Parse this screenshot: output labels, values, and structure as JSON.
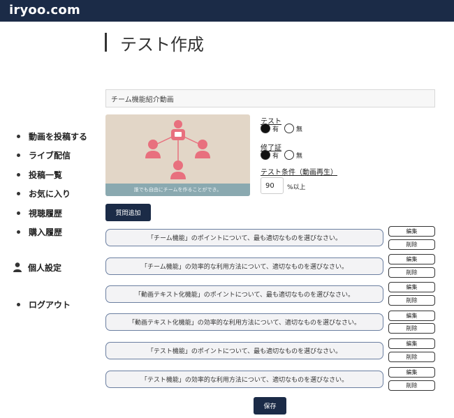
{
  "header": {
    "logo": "iryoo.com"
  },
  "sidebar": {
    "items": [
      {
        "label": "動画を投稿する"
      },
      {
        "label": "ライブ配信"
      },
      {
        "label": "投稿一覧"
      },
      {
        "label": "お気に入り"
      },
      {
        "label": "視聴履歴"
      },
      {
        "label": "購入履歴"
      },
      {
        "label": "個人設定"
      },
      {
        "label": "ログアウト"
      }
    ]
  },
  "page": {
    "title": "テスト作成"
  },
  "video": {
    "title_value": "チーム機能紹介動画",
    "thumbnail_caption": "誰でも自由にチームを作ることができ。"
  },
  "settings": {
    "test": {
      "label": "テスト",
      "yes": "有",
      "no": "無",
      "selected": "有"
    },
    "certificate": {
      "label": "修了証",
      "yes": "有",
      "no": "無",
      "selected": "有"
    },
    "condition": {
      "label": "テスト条件（動画再生）",
      "value": "90",
      "suffix": "%以上"
    }
  },
  "questions": {
    "add_label": "質問追加",
    "edit_label": "編集",
    "delete_label": "削除",
    "items": [
      "「チーム機能」のポイントについて、最も適切なものを選びなさい。",
      "「チーム機能」の効率的な利用方法について、適切なものを選びなさい。",
      "「動画テキスト化機能」のポイントについて、最も適切なものを選びなさい。",
      "「動画テキスト化機能」の効率的な利用方法について、適切なものを選びなさい。",
      "「テスト機能」のポイントについて、最も適切なものを選びなさい。",
      "「テスト機能」の効率的な利用方法について、適切なものを選びなさい。"
    ]
  },
  "footer": {
    "save_label": "保存"
  },
  "colors": {
    "navy": "#1b2b47",
    "thumb_bg": "#e2d6c7",
    "people": "#e8707e",
    "caption_bar": "#8aa9b0"
  },
  "icons": {
    "person": "person-icon",
    "network": "team-network-illustration"
  }
}
